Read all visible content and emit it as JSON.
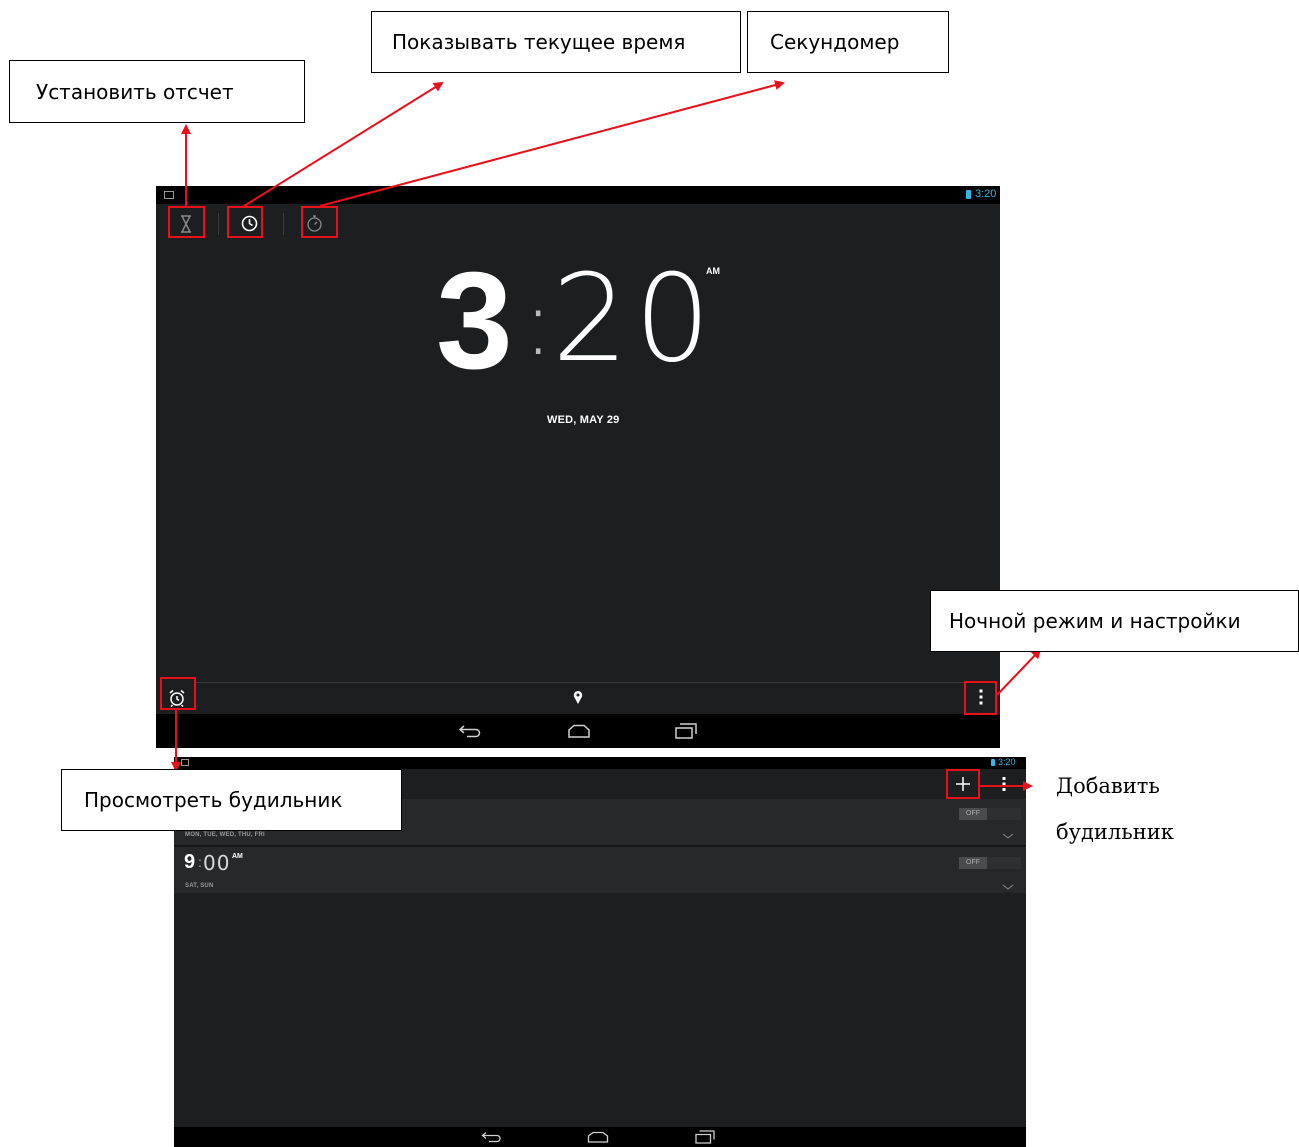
{
  "callouts": {
    "set_timer": "Установить отсчет",
    "show_time": "Показывать текущее время",
    "stopwatch": "Секундомер",
    "night_mode": "Ночной режим и настройки",
    "view_alarms": "Просмотреть будильник",
    "add_alarm_line1": "Добавить",
    "add_alarm_line2": "будильник"
  },
  "screen1": {
    "status_time": "3:20",
    "clock_hour": "3",
    "clock_colon": ":",
    "clock_minutes": "20",
    "clock_ampm": "AM",
    "date": "WED, MAY 29"
  },
  "screen2": {
    "status_time": "3:20",
    "alarms": [
      {
        "days": "MON, TUE, WED, THU, FRI",
        "toggle": "OFF"
      },
      {
        "hour": "9",
        "colon": ":",
        "minutes": "00",
        "ampm": "AM",
        "days": "SAT, SUN",
        "toggle": "OFF"
      }
    ]
  },
  "colors": {
    "accent": "#33b5e5",
    "annotation": "#e8101a",
    "screen_bg": "#1d1e20"
  }
}
